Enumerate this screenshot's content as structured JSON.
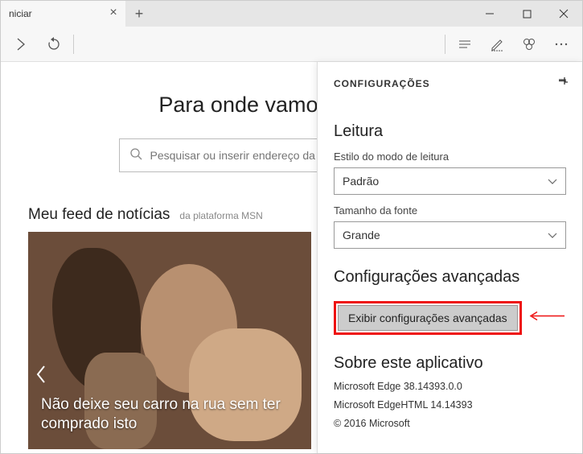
{
  "tab": {
    "title": "niciar"
  },
  "hero": {
    "title": "Para onde vamos a seguir?"
  },
  "search": {
    "placeholder": "Pesquisar ou inserir endereço da Web"
  },
  "feed": {
    "title": "Meu feed de notícias",
    "subtitle": "da plataforma MSN",
    "card_caption": "Não deixe seu carro na rua sem ter comprado isto"
  },
  "settings": {
    "header": "CONFIGURAÇÕES",
    "reading": {
      "title": "Leitura",
      "style_label": "Estilo do modo de leitura",
      "style_value": "Padrão",
      "font_label": "Tamanho da fonte",
      "font_value": "Grande"
    },
    "advanced": {
      "title": "Configurações avançadas",
      "button": "Exibir configurações avançadas"
    },
    "about": {
      "title": "Sobre este aplicativo",
      "line1": "Microsoft Edge 38.14393.0.0",
      "line2": "Microsoft EdgeHTML 14.14393",
      "line3": "© 2016 Microsoft"
    }
  }
}
